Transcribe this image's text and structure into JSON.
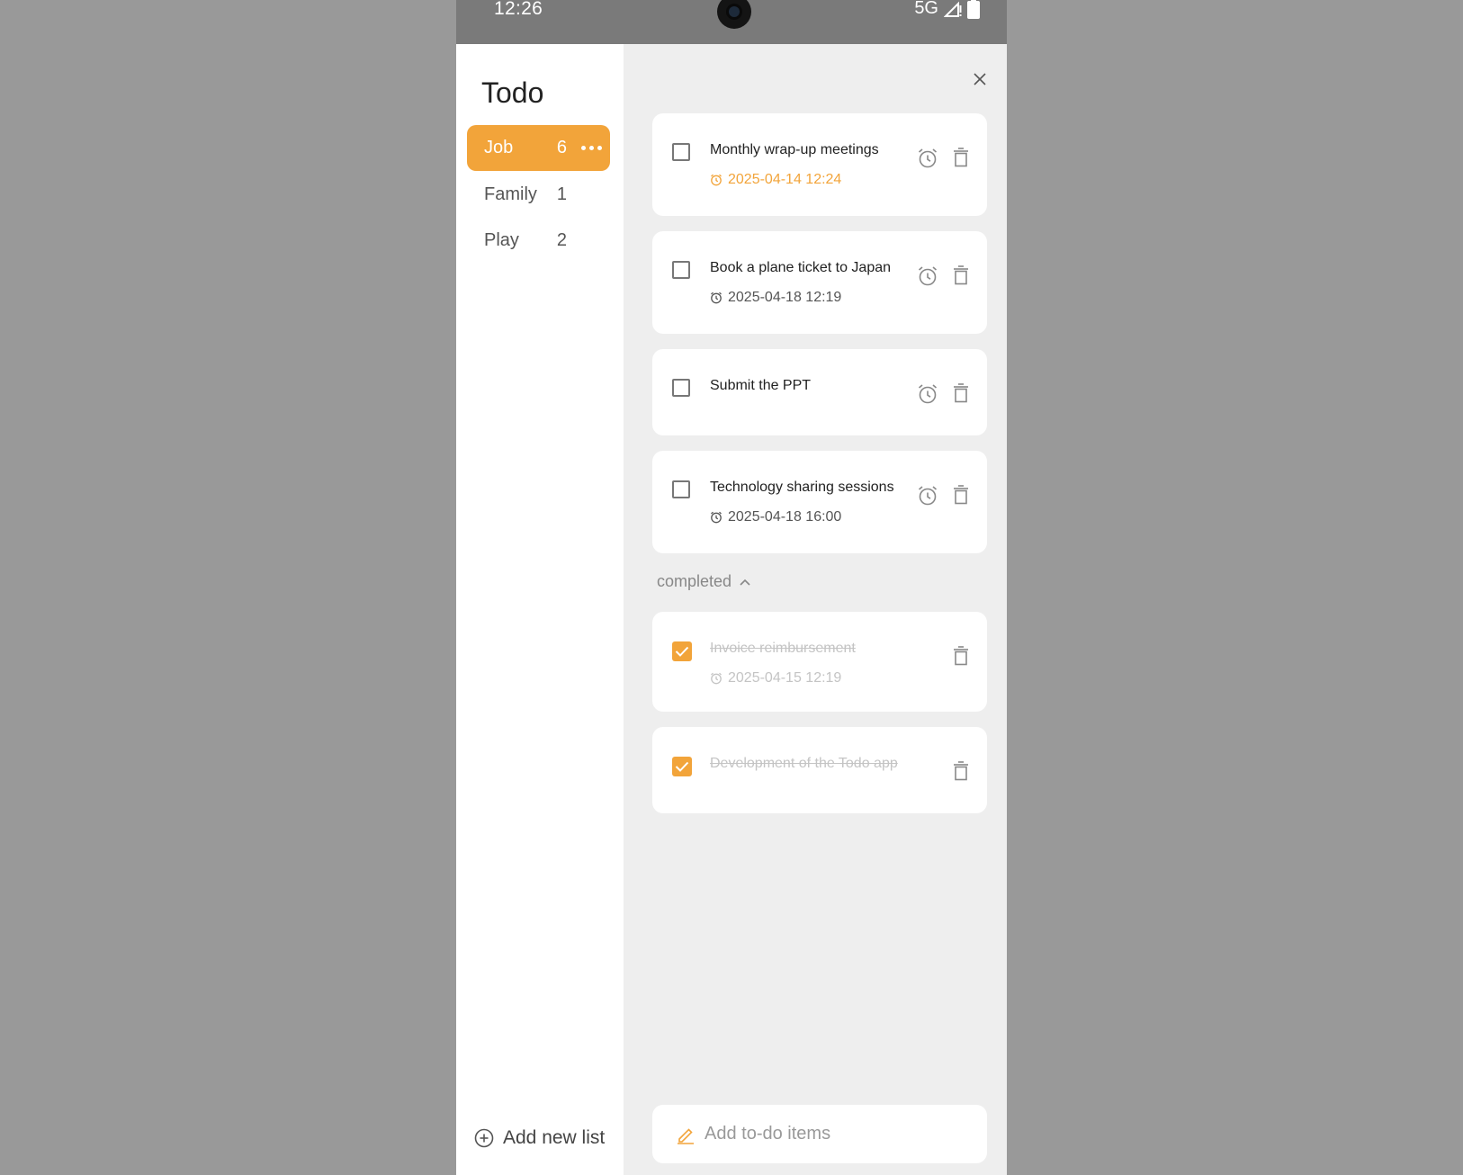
{
  "status_bar": {
    "time": "12:26",
    "network": "5G"
  },
  "sidebar": {
    "title": "Todo",
    "lists": [
      {
        "name": "Job",
        "count": "6",
        "active": true
      },
      {
        "name": "Family",
        "count": "1",
        "active": false
      },
      {
        "name": "Play",
        "count": "2",
        "active": false
      }
    ],
    "add_list_label": "Add new list"
  },
  "tasks": [
    {
      "title": "Monthly wrap-up meetings",
      "date": "2025-04-14 12:24",
      "overdue": true
    },
    {
      "title": "Book a plane ticket to Japan",
      "date": "2025-04-18 12:19",
      "overdue": false
    },
    {
      "title": "Submit the PPT",
      "date": "",
      "overdue": false
    },
    {
      "title": "Technology sharing sessions",
      "date": "2025-04-18 16:00",
      "overdue": false
    }
  ],
  "completed": {
    "label": "completed",
    "items": [
      {
        "title": "Invoice reimbursement",
        "date": "2025-04-15 12:19"
      },
      {
        "title": "Development of the Todo app",
        "date": ""
      }
    ]
  },
  "add_todo": {
    "placeholder": "Add to-do items"
  },
  "colors": {
    "accent": "#f2a43a",
    "background": "#eeeeee",
    "card": "#ffffff"
  },
  "icons": [
    "close-icon",
    "alarm-icon",
    "trash-icon",
    "clock-icon",
    "chevron-up-icon",
    "plus-circle-icon",
    "pencil-icon",
    "signal-icon",
    "battery-icon"
  ]
}
